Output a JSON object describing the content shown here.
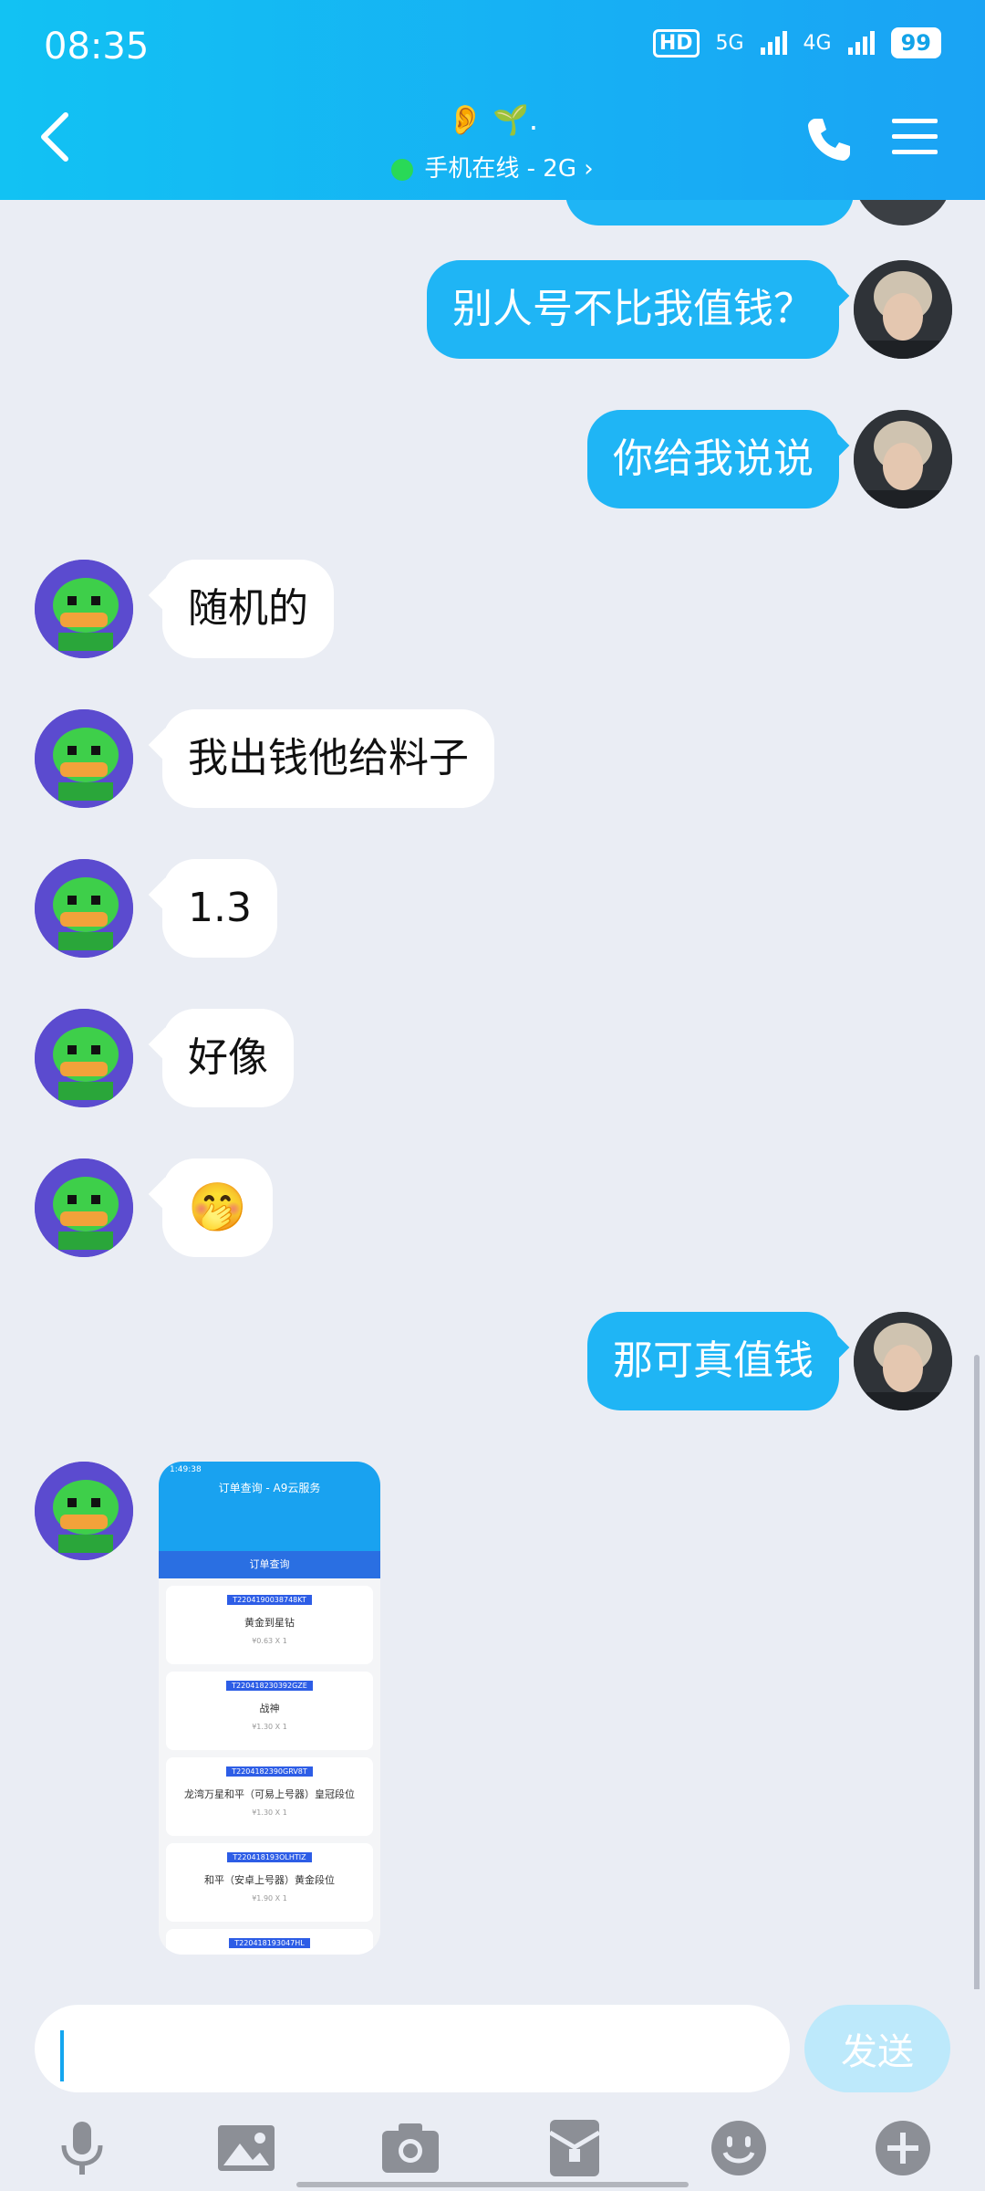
{
  "status_bar": {
    "time": "08:35",
    "hd_label": "HD",
    "network1": "5G",
    "network2": "4G",
    "battery": "99"
  },
  "header": {
    "title_emoji": "👂 🌱.",
    "presence": "手机在线 - 2G ›"
  },
  "messages": [
    {
      "side": "out",
      "text": "别人号不比我值钱？"
    },
    {
      "side": "out",
      "text": "你给我说说"
    },
    {
      "side": "in",
      "text": "随机的"
    },
    {
      "side": "in",
      "text": "我出钱他给料子"
    },
    {
      "side": "in",
      "text": "1.3"
    },
    {
      "side": "in",
      "text": "好像"
    },
    {
      "side": "in",
      "text": "🤭"
    },
    {
      "side": "out",
      "text": "那可真值钱"
    }
  ],
  "image_message": {
    "top_status": "1:49:38",
    "app_title": "订单查询 - A9云服务",
    "bar_title": "订单查询",
    "orders": [
      {
        "id": "T2204190038748KT",
        "name": "黄金到星钻",
        "price": "¥0.63 X 1"
      },
      {
        "id": "T220418230392GZE",
        "name": "战神",
        "price": "¥1.30 X 1"
      },
      {
        "id": "T2204182390GRV8T",
        "name": "龙湾万星和平（可易上号器）皇冠段位",
        "price": "¥1.30 X 1"
      },
      {
        "id": "T220418193OLHTIZ",
        "name": "和平（安卓上号器）黄金段位",
        "price": "¥1.90 X 1"
      },
      {
        "id": "T220418193047HL",
        "name": "",
        "price": ""
      }
    ]
  },
  "composer": {
    "input_value": "",
    "send_label": "发送"
  },
  "toolbar_icons": [
    "microphone-icon",
    "image-icon",
    "camera-icon",
    "red-packet-icon",
    "emoji-icon",
    "plus-icon"
  ],
  "colors": {
    "header_start": "#12c2f3",
    "header_end": "#1aa3f4",
    "bubble_out": "#1fb5f5",
    "bubble_in": "#ffffff",
    "background": "#eaedf4"
  }
}
